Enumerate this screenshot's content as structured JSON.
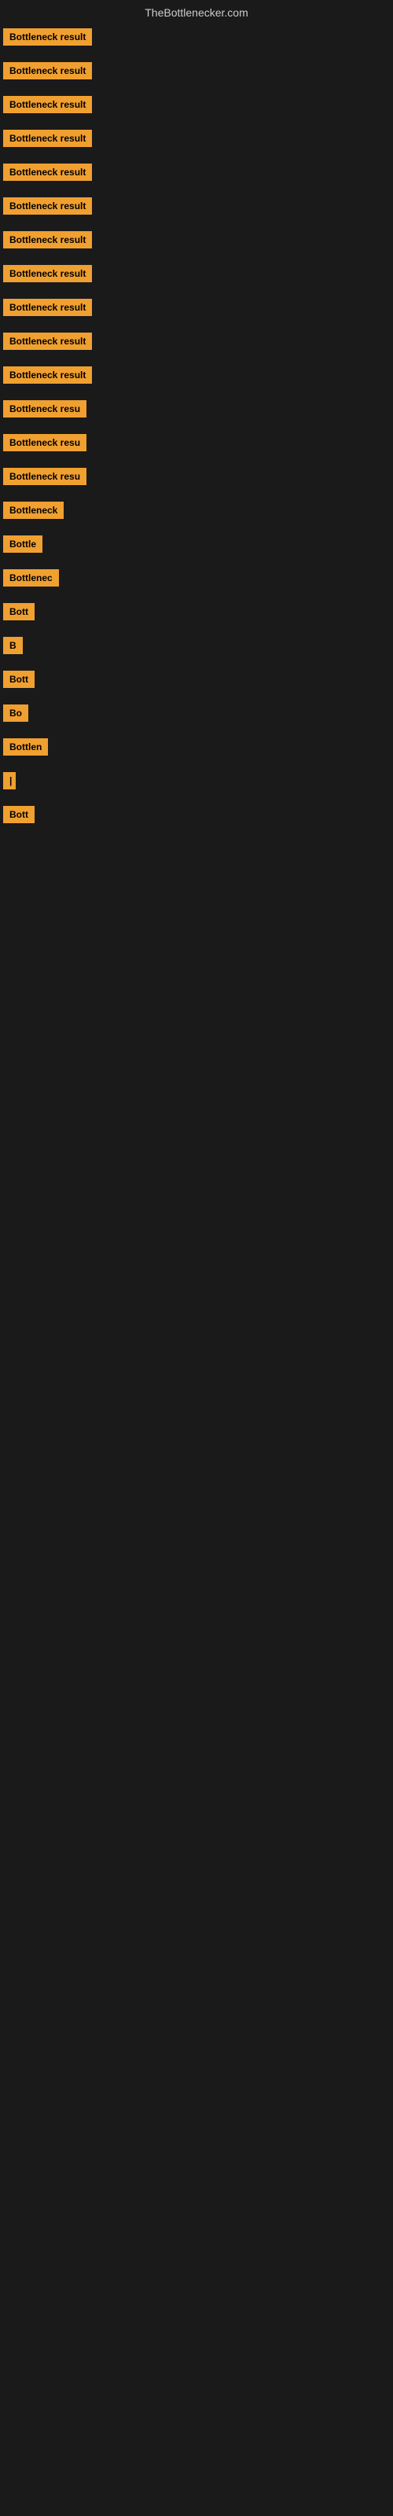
{
  "site": {
    "title": "TheBottlenecker.com"
  },
  "items": [
    {
      "id": 1,
      "label": "Bottleneck result",
      "truncClass": "full",
      "topOffset": 10
    },
    {
      "id": 2,
      "label": "Bottleneck result",
      "truncClass": "full",
      "topOffset": 57
    },
    {
      "id": 3,
      "label": "Bottleneck result",
      "truncClass": "full",
      "topOffset": 144
    },
    {
      "id": 4,
      "label": "Bottleneck result",
      "truncClass": "full",
      "topOffset": 234
    },
    {
      "id": 5,
      "label": "Bottleneck result",
      "truncClass": "full",
      "topOffset": 321
    },
    {
      "id": 6,
      "label": "Bottleneck result",
      "truncClass": "full",
      "topOffset": 410
    },
    {
      "id": 7,
      "label": "Bottleneck result",
      "truncClass": "full",
      "topOffset": 497
    },
    {
      "id": 8,
      "label": "Bottleneck result",
      "truncClass": "full",
      "topOffset": 586
    },
    {
      "id": 9,
      "label": "Bottleneck result",
      "truncClass": "full",
      "topOffset": 675
    },
    {
      "id": 10,
      "label": "Bottleneck result",
      "truncClass": "full",
      "topOffset": 762
    },
    {
      "id": 11,
      "label": "Bottleneck result",
      "truncClass": "full",
      "topOffset": 849
    },
    {
      "id": 12,
      "label": "Bottleneck resu",
      "truncClass": "trunc1",
      "topOffset": 936
    },
    {
      "id": 13,
      "label": "Bottleneck resu",
      "truncClass": "trunc1",
      "topOffset": 1020
    },
    {
      "id": 14,
      "label": "Bottleneck resu",
      "truncClass": "trunc1",
      "topOffset": 1106
    },
    {
      "id": 15,
      "label": "Bottleneck",
      "truncClass": "trunc2",
      "topOffset": 1190
    },
    {
      "id": 16,
      "label": "Bottle",
      "truncClass": "trunc3",
      "topOffset": 1274
    },
    {
      "id": 17,
      "label": "Bottlenec",
      "truncClass": "trunc2",
      "topOffset": 1358
    },
    {
      "id": 18,
      "label": "Bott",
      "truncClass": "trunc4",
      "topOffset": 1442
    },
    {
      "id": 19,
      "label": "B",
      "truncClass": "trunc6",
      "topOffset": 1528
    },
    {
      "id": 20,
      "label": "Bott",
      "truncClass": "trunc4",
      "topOffset": 1614
    },
    {
      "id": 21,
      "label": "Bo",
      "truncClass": "trunc5",
      "topOffset": 1700
    },
    {
      "id": 22,
      "label": "Bottlen",
      "truncClass": "trunc3",
      "topOffset": 1786
    },
    {
      "id": 23,
      "label": "|",
      "truncClass": "trunc7",
      "topOffset": 1872
    },
    {
      "id": 24,
      "label": "Bott",
      "truncClass": "trunc4",
      "topOffset": 1960
    }
  ]
}
